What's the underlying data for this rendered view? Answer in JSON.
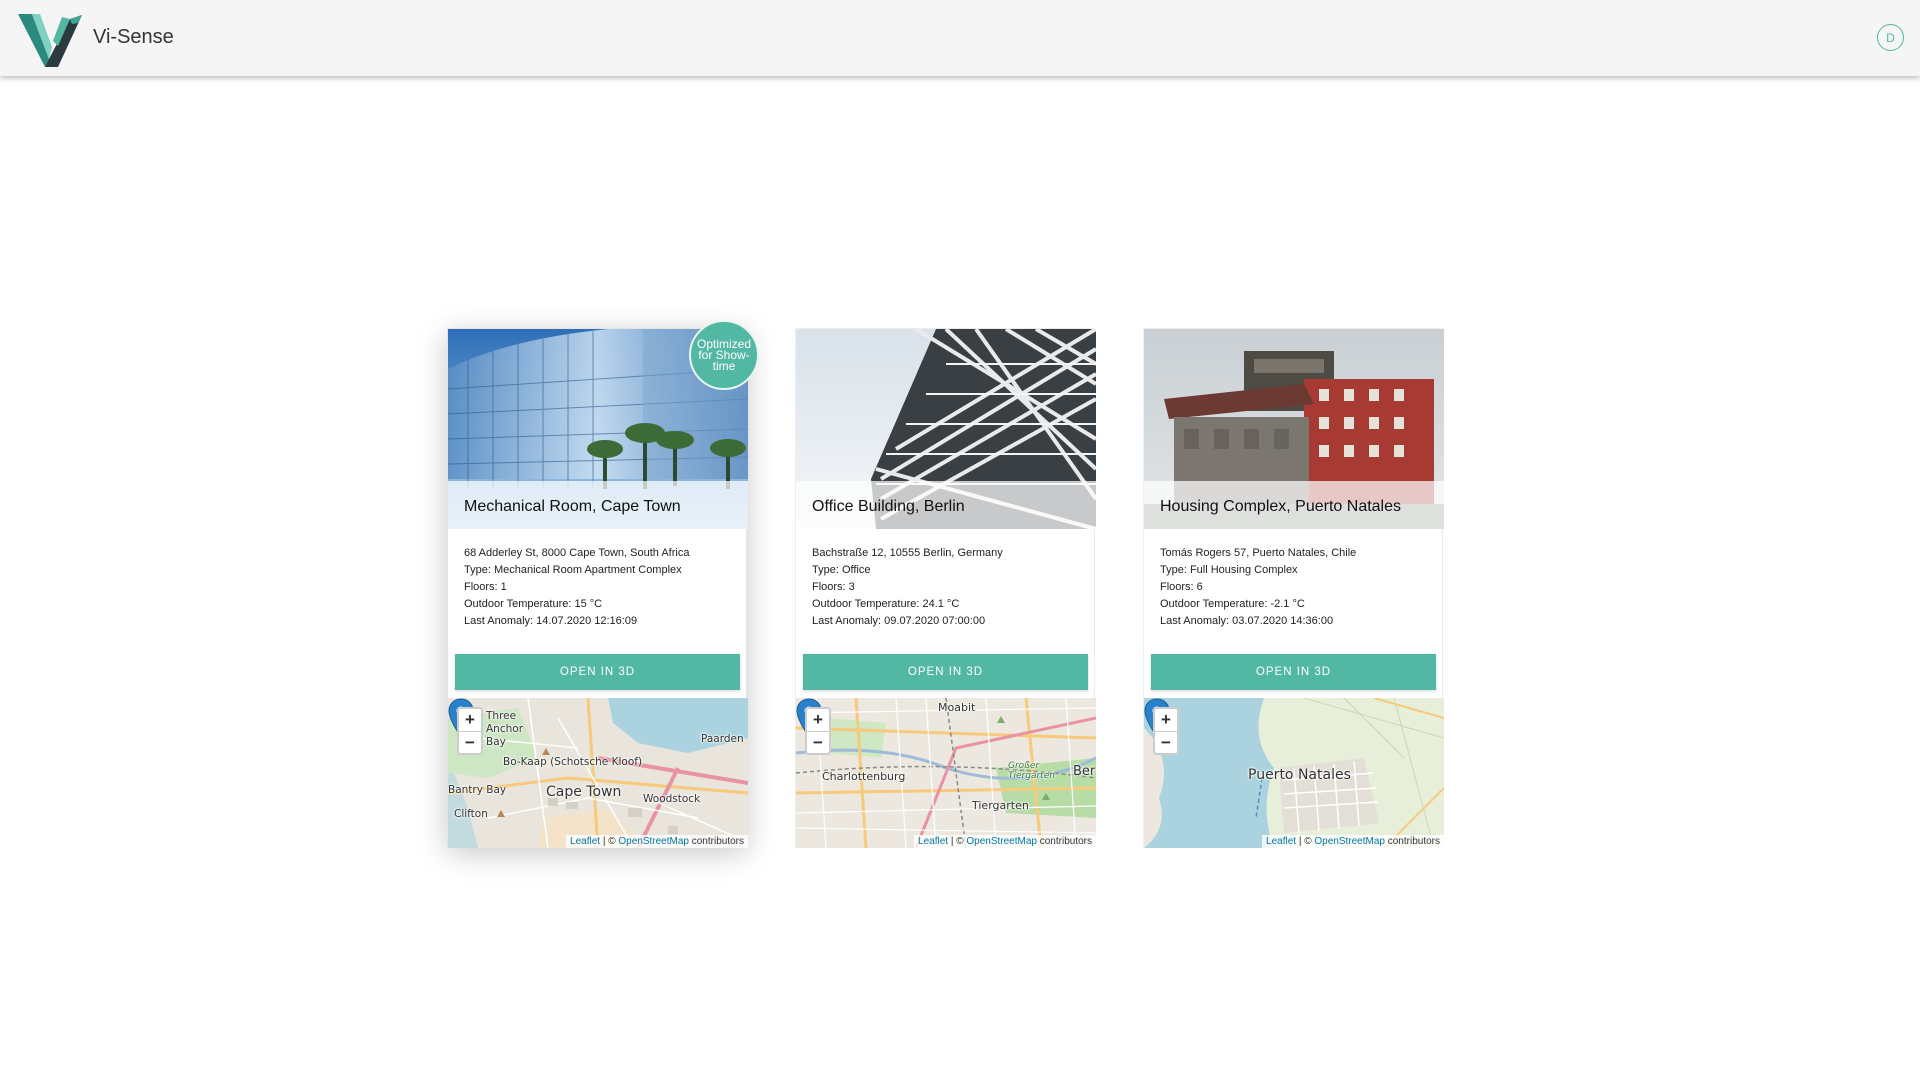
{
  "app": {
    "title": "Vi-Sense",
    "user_initial": "D",
    "accent_color": "#52b8a3"
  },
  "cards": [
    {
      "title": "Mechanical Room, Cape Town",
      "badge": "Optimized for Show-time",
      "address": "68 Adderley St, 8000 Cape Town, South Africa",
      "type": "Type: Mechanical Room Apartment Complex",
      "floors": "Floors: 1",
      "outdoor_temperature": "Outdoor Temperature: 15 °C",
      "last_anomaly": "Last Anomaly: 14.07.2020 12:16:09",
      "button": "OPEN IN 3D",
      "map": {
        "labels": [
          "Three Anchor Bay",
          "Bo-Kaap (Schotsche Kloof)",
          "Cape Town",
          "Woodstock",
          "Paarden",
          "Bantry Bay",
          "Clifton"
        ]
      }
    },
    {
      "title": "Office Building, Berlin",
      "badge": "",
      "address": "Bachstraße 12, 10555 Berlin, Germany",
      "type": "Type: Office",
      "floors": "Floors: 3",
      "outdoor_temperature": "Outdoor Temperature: 24.1 °C",
      "last_anomaly": "Last Anomaly: 09.07.2020 07:00:00",
      "button": "OPEN IN 3D",
      "map": {
        "labels": [
          "Moabit",
          "Charlottenburg",
          "Tiergarten",
          "Großer Tiergarten",
          "Ber"
        ]
      }
    },
    {
      "title": "Housing Complex, Puerto Natales",
      "badge": "",
      "address": "Tomás Rogers 57, Puerto Natales, Chile",
      "type": "Type: Full Housing Complex",
      "floors": "Floors: 6",
      "outdoor_temperature": "Outdoor Temperature: -2.1 °C",
      "last_anomaly": "Last Anomaly: 03.07.2020 14:36:00",
      "button": "OPEN IN 3D",
      "map": {
        "labels": [
          "Puerto Natales"
        ]
      }
    }
  ],
  "map_controls": {
    "zoom_in": "+",
    "zoom_out": "−",
    "attribution_leaflet": "Leaflet",
    "attribution_sep": " | © ",
    "attribution_osm": "OpenStreetMap",
    "attribution_suffix": " contributors"
  }
}
